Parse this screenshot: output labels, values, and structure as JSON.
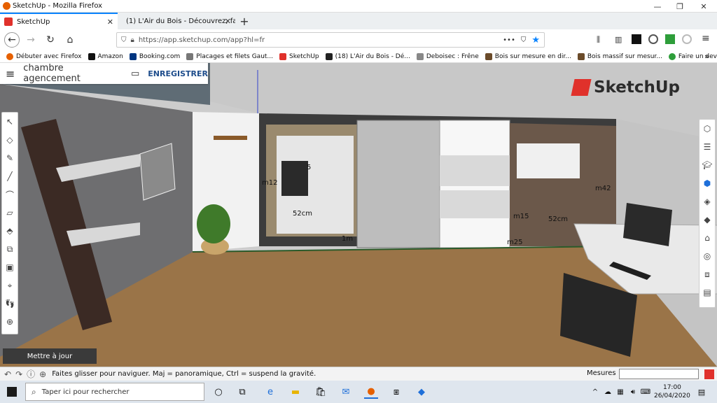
{
  "window": {
    "title": "SketchUp - Mozilla Firefox",
    "minimize_label": "—",
    "maximize_label": "❐",
    "close_label": "✕"
  },
  "tabs": [
    {
      "label": "SketchUp",
      "icon": "sketchup-icon",
      "active": true
    },
    {
      "label": "(1) L'Air du Bois - Découvrez, fa",
      "icon": "lairdubois-icon",
      "active": false
    }
  ],
  "new_tab_label": "+",
  "nav": {
    "url": "https://app.sketchup.com/app?hl=fr",
    "more_label": "•••"
  },
  "bookmarks": [
    {
      "label": "Débuter avec Firefox",
      "color": "#e66000"
    },
    {
      "label": "Amazon",
      "color": "#111111"
    },
    {
      "label": "Booking.com",
      "color": "#003580"
    },
    {
      "label": "Placages et filets Gaut...",
      "color": "#777777"
    },
    {
      "label": "SketchUp",
      "color": "#e0312b"
    },
    {
      "label": "(18) L'Air du Bois - Dé...",
      "color": "#222222"
    },
    {
      "label": "Deboisec : Frêne",
      "color": "#888888"
    },
    {
      "label": "Bois sur mesure en dir...",
      "color": "#6b4b2a"
    },
    {
      "label": "Bois massif sur mesur...",
      "color": "#6b4b2a"
    },
    {
      "label": "Faire un devis en ligne...",
      "color": "#2e9e3a"
    }
  ],
  "bookmarks_more": "»",
  "app": {
    "project_name": "chambre agencement",
    "save_label": "ENREGISTRER",
    "logo_text": "SketchUp",
    "update_button": "Mettre à jour",
    "brand_red": "#e0312b"
  },
  "dimensions": {
    "d1": "5",
    "d2": "m12",
    "d3": "52cm",
    "d4": "1m",
    "d5": "m15",
    "d6": "52cm",
    "d7": "m25",
    "d8": "m42"
  },
  "status": {
    "hint": "Faites glisser pour naviguer. Maj = panoramique, Ctrl = suspend la gravité.",
    "measures_label": "Mesures"
  },
  "taskbar": {
    "search_placeholder": "Taper ici pour rechercher",
    "time": "17:00",
    "date": "26/04/2020"
  }
}
